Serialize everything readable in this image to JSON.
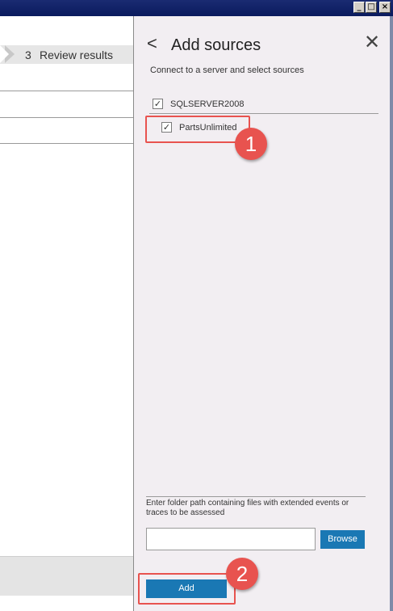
{
  "window": {
    "controls": {
      "minimize": "_",
      "maximize": "□",
      "close": "×"
    }
  },
  "wizard": {
    "step": {
      "number": "3",
      "label": "Review results"
    }
  },
  "panel": {
    "back_glyph": "<",
    "title": "Add sources",
    "close_glyph": "✕",
    "subtitle": "Connect to a server and select sources",
    "server": {
      "name": "SQLSERVER2008",
      "checked": true
    },
    "databases": [
      {
        "name": "PartsUnlimited",
        "checked": true
      }
    ],
    "path_description": "Enter folder path containing files with extended events or traces to be assessed",
    "path_input": {
      "value": "",
      "placeholder": ""
    },
    "browse_label": "Browse",
    "add_label": "Add"
  },
  "callouts": [
    "1",
    "2"
  ],
  "colors": {
    "accent": "#1a78b4",
    "callout": "#e8534f",
    "panel_bg": "#f2eef2"
  },
  "check_glyph": "✓"
}
